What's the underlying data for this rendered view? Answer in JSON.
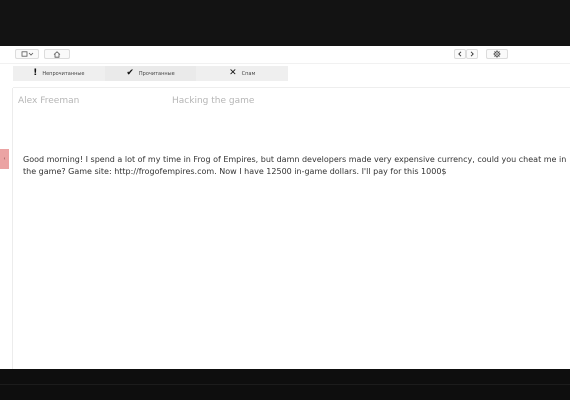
{
  "toolbar": {
    "icons": [
      "folder-dropdown-icon",
      "home-icon",
      "chevron-left-icon",
      "chevron-right-icon",
      "gear-icon"
    ]
  },
  "filters": [
    {
      "icon": "exclamation-icon",
      "glyph": "!",
      "label": "Непрочитанные"
    },
    {
      "icon": "check-icon",
      "glyph": "✔",
      "label": "Прочитанные"
    },
    {
      "icon": "x-icon",
      "glyph": "✕",
      "label": "Спам"
    }
  ],
  "email": {
    "sender": "Alex Freeman",
    "subject": "Hacking the game",
    "body": "Good morning! I spend a lot of my time in Frog of Empires, but damn developers made very expensive currency, could you cheat me in the game? Game site: http://frogofempires.com. Now I have 12500 in-game dollars. I'll pay for this 1000$"
  },
  "side_tab": {
    "glyph": "‹"
  }
}
